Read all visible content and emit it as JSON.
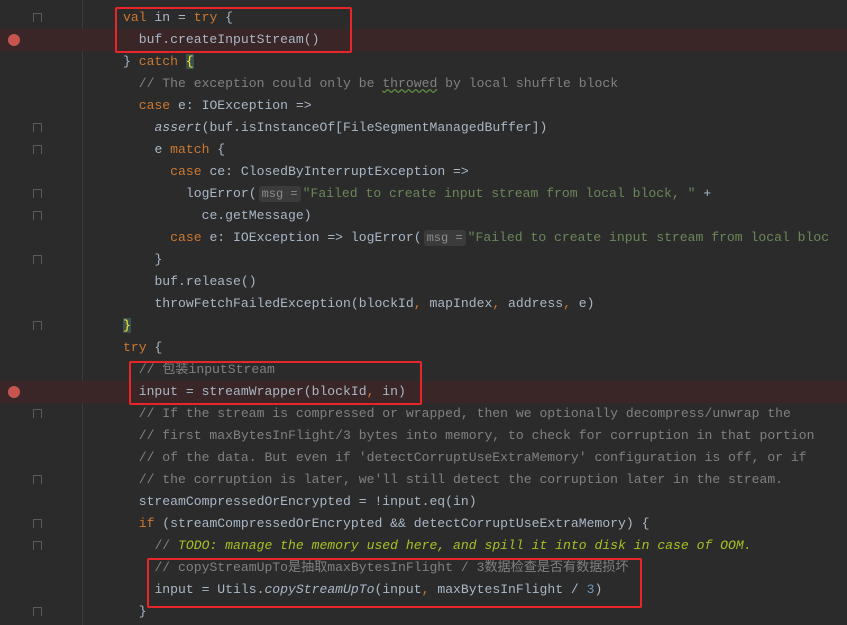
{
  "colors": {
    "keyword": "#cc7832",
    "text": "#a9b7c6",
    "comment": "#808080",
    "string": "#6a8759",
    "number": "#6897bb",
    "todo": "#a8c023",
    "breakpoint": "#c75450",
    "highlight_box": "#e8262a"
  },
  "lines": [
    {
      "indent": 0,
      "fold": true,
      "tokens": [
        [
          "val",
          "kw"
        ],
        " in = ",
        [
          "try",
          "kw"
        ],
        " {"
      ]
    },
    {
      "indent": 2,
      "breakpoint": true,
      "tokens": [
        "buf.createInputStream()"
      ]
    },
    {
      "indent": 0,
      "tokens": [
        "} ",
        [
          "catch",
          "kw"
        ],
        " ",
        [
          "{",
          "brace"
        ]
      ]
    },
    {
      "indent": 2,
      "tokens": [
        [
          "// The exception could only be ",
          "cm"
        ],
        [
          "throwed",
          "cm typo"
        ],
        [
          " by local shuffle block",
          "cm"
        ]
      ]
    },
    {
      "indent": 2,
      "tokens": [
        [
          "case",
          "kw"
        ],
        " e: IOException =>"
      ]
    },
    {
      "indent": 4,
      "fold": true,
      "tokens": [
        [
          "assert",
          "it"
        ],
        "(buf.isInstanceOf[FileSegmentManagedBuffer])"
      ]
    },
    {
      "indent": 4,
      "fold": true,
      "tokens": [
        "e ",
        [
          "match",
          "kw"
        ],
        " {"
      ]
    },
    {
      "indent": 6,
      "tokens": [
        [
          "case",
          "kw"
        ],
        " ce: ClosedByInterruptException =>"
      ]
    },
    {
      "indent": 8,
      "fold": true,
      "tokens": [
        "logError(",
        [
          "msg =",
          "hint"
        ],
        [
          "\"Failed to create input stream from local block, \"",
          "str"
        ],
        " +"
      ]
    },
    {
      "indent": 10,
      "fold": true,
      "tokens": [
        "ce.getMessage)"
      ]
    },
    {
      "indent": 6,
      "tokens": [
        [
          "case",
          "kw"
        ],
        " e: IOException => logError(",
        [
          "msg =",
          "hint"
        ],
        [
          "\"Failed to create input stream from local bloc",
          "str"
        ]
      ]
    },
    {
      "indent": 4,
      "fold": true,
      "tokens": [
        "}"
      ]
    },
    {
      "indent": 4,
      "tokens": [
        "buf.release()"
      ]
    },
    {
      "indent": 4,
      "tokens": [
        "throwFetchFailedException(blockId",
        [
          ",",
          "kw"
        ],
        " mapIndex",
        [
          ",",
          "kw"
        ],
        " address",
        [
          ",",
          "kw"
        ],
        " e)"
      ]
    },
    {
      "indent": 0,
      "fold": true,
      "tokens": [
        [
          "}",
          "brace"
        ]
      ]
    },
    {
      "indent": 0,
      "tokens": [
        [
          "try",
          "kw"
        ],
        " {"
      ]
    },
    {
      "indent": 2,
      "tokens": [
        [
          "// 包装inputStream",
          "cm"
        ]
      ]
    },
    {
      "indent": 2,
      "breakpoint": true,
      "tokens": [
        "input = streamWrapper(blockId",
        [
          ",",
          "kw"
        ],
        " in)"
      ]
    },
    {
      "indent": 2,
      "fold": true,
      "tokens": [
        [
          "// If the stream is compressed or wrapped, then we optionally decompress/unwrap the",
          "cm"
        ]
      ]
    },
    {
      "indent": 2,
      "tokens": [
        [
          "// first maxBytesInFlight/3 bytes into memory, to check for corruption in that portion",
          "cm"
        ]
      ]
    },
    {
      "indent": 2,
      "tokens": [
        [
          "// of the data. But even if 'detectCorruptUseExtraMemory' configuration is off, or if",
          "cm"
        ]
      ]
    },
    {
      "indent": 2,
      "fold": true,
      "tokens": [
        [
          "// the corruption is later, we'll still detect the corruption later in the stream.",
          "cm"
        ]
      ]
    },
    {
      "indent": 2,
      "tokens": [
        "streamCompressedOrEncrypted = !input.eq(in)"
      ]
    },
    {
      "indent": 2,
      "fold": true,
      "tokens": [
        [
          "if",
          "kw"
        ],
        " (streamCompressedOrEncrypted && detectCorruptUseExtraMemory) {"
      ]
    },
    {
      "indent": 4,
      "fold": true,
      "tokens": [
        [
          "// ",
          "cm"
        ],
        [
          "TODO: manage the memory used here, and spill it into disk in case of OOM.",
          "todo"
        ]
      ]
    },
    {
      "indent": 4,
      "tokens": [
        [
          "// copyStreamUpTo是抽取maxBytesInFlight / 3数据检查是否有数据损坏",
          "cm"
        ]
      ]
    },
    {
      "indent": 4,
      "tokens": [
        "input = Utils.",
        [
          "copyStreamUpTo",
          "it"
        ],
        "(input",
        [
          ",",
          "kw"
        ],
        " maxBytesInFlight / ",
        [
          "3",
          "num"
        ],
        ")"
      ]
    },
    {
      "indent": 2,
      "fold": true,
      "tokens": [
        "}"
      ]
    }
  ]
}
